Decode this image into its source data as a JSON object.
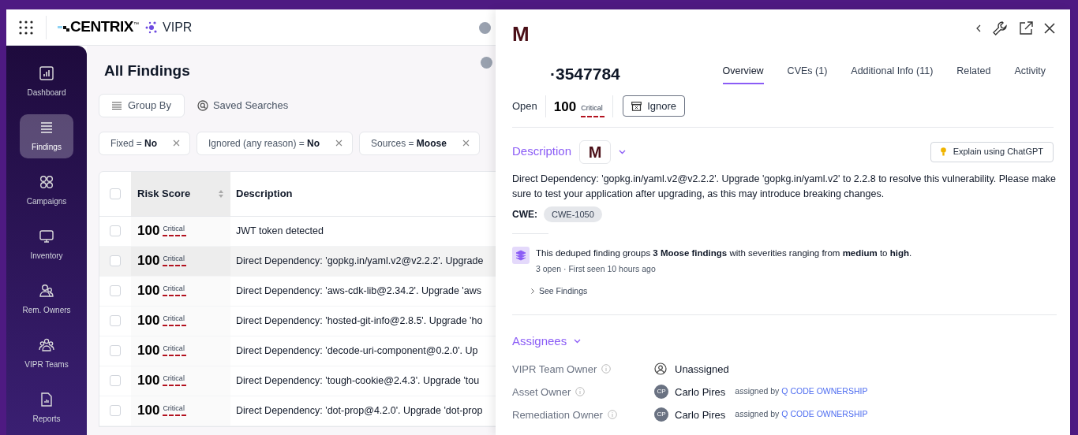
{
  "header": {
    "logo": "CENTRIX",
    "logo_mark": "™",
    "app": "VIPR"
  },
  "sidebar": {
    "items": [
      {
        "label": "Dashboard",
        "selected": false
      },
      {
        "label": "Findings",
        "selected": true
      },
      {
        "label": "Campaigns",
        "selected": false
      },
      {
        "label": "Inventory",
        "selected": false
      },
      {
        "label": "Rem. Owners",
        "selected": false
      },
      {
        "label": "VIPR Teams",
        "selected": false
      },
      {
        "label": "Reports",
        "selected": false
      }
    ]
  },
  "main": {
    "title": "All Findings",
    "group_by": "Group By",
    "saved_searches": "Saved Searches",
    "filters": [
      {
        "label": "Fixed = ",
        "value": "No"
      },
      {
        "label": "Ignored (any reason) = ",
        "value": "No"
      },
      {
        "label": "Sources = ",
        "value": "Moose"
      }
    ],
    "table": {
      "select_all_checked": false,
      "columns": [
        "Risk Score",
        "Description"
      ],
      "rows": [
        {
          "score": "100",
          "severity": "Critical",
          "description": "JWT token detected",
          "selected": false,
          "checked": false
        },
        {
          "score": "100",
          "severity": "Critical",
          "description": "Direct Dependency: 'gopkg.in/yaml.v2@v2.2.2'. Upgrade",
          "selected": true,
          "checked": false
        },
        {
          "score": "100",
          "severity": "Critical",
          "description": "Direct Dependency: 'aws-cdk-lib@2.34.2'. Upgrade 'aws",
          "selected": false,
          "checked": false
        },
        {
          "score": "100",
          "severity": "Critical",
          "description": "Direct Dependency: 'hosted-git-info@2.8.5'. Upgrade 'ho",
          "selected": false,
          "checked": false
        },
        {
          "score": "100",
          "severity": "Critical",
          "description": "Direct Dependency: 'decode-uri-component@0.2.0'. Up",
          "selected": false,
          "checked": false
        },
        {
          "score": "100",
          "severity": "Critical",
          "description": "Direct Dependency: 'tough-cookie@2.4.3'. Upgrade 'tou",
          "selected": false,
          "checked": false
        },
        {
          "score": "100",
          "severity": "Critical",
          "description": "Direct Dependency: 'dot-prop@4.2.0'. Upgrade 'dot-prop",
          "selected": false,
          "checked": false
        }
      ]
    }
  },
  "panel": {
    "logo": "M",
    "id": "·3547784",
    "tabs": [
      {
        "label": "Overview",
        "selected": true
      },
      {
        "label": "CVEs (1)",
        "selected": false
      },
      {
        "label": "Additional Info (11)",
        "selected": false
      },
      {
        "label": "Related",
        "selected": false
      },
      {
        "label": "Activity",
        "selected": false
      }
    ],
    "status": "Open",
    "score": "100",
    "severity": "Critical",
    "ignore": "Ignore",
    "description_title": "Description",
    "description_badge": "M",
    "chatgpt": "Explain using ChatGPT",
    "description": "Direct Dependency: 'gopkg.in/yaml.v2@v2.2.2'. Upgrade 'gopkg.in/yaml.v2' to 2.2.8 to resolve this vulnerability. Please make sure to test your application after upgrading, as this may introduce breaking changes.",
    "cwe_label": "CWE:",
    "cwe": "CWE-1050",
    "dedup": "This deduped finding groups **3 Moose findings** with severities ranging from **medium** to **high**.",
    "dedup_meta": "3 open · First seen 10 hours ago",
    "see_findings": "See Findings",
    "assignees_title": "Assignees",
    "assignees": [
      {
        "role": "VIPR Team Owner",
        "kind": "unassigned",
        "name": "Unassigned"
      },
      {
        "role": "Asset Owner",
        "kind": "person",
        "initials": "CP",
        "name": "Carlo Pires",
        "assigned_by": "assigned by",
        "source": "Q CODE OWNERSHIP"
      },
      {
        "role": "Remediation Owner",
        "kind": "person",
        "initials": "CP",
        "name": "Carlo Pires",
        "assigned_by": "assigned by",
        "source": "Q CODE OWNERSHIP"
      }
    ]
  }
}
